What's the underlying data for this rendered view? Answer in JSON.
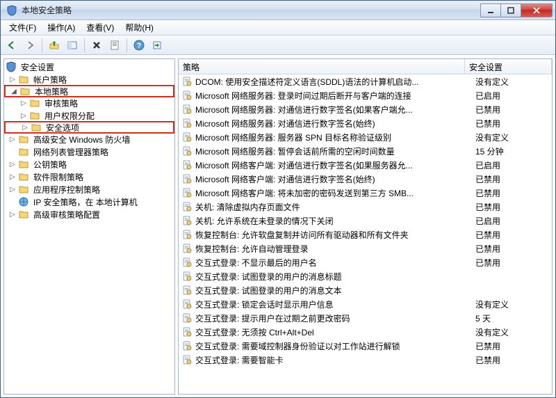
{
  "window": {
    "title": "本地安全策略"
  },
  "menubar": [
    {
      "label": "文件(F)"
    },
    {
      "label": "操作(A)"
    },
    {
      "label": "查看(V)"
    },
    {
      "label": "帮助(H)"
    }
  ],
  "toolbar_icons": [
    "back-arrow-icon",
    "forward-arrow-icon",
    "up-folder-icon",
    "show-hide-icon",
    "delete-icon",
    "properties-icon",
    "help-icon",
    "export-icon"
  ],
  "tree": {
    "root": {
      "label": "安全设置",
      "icon": "shield"
    },
    "nodes": [
      {
        "label": "帐户策略",
        "icon": "folder",
        "depth": 1,
        "expand": "closed"
      },
      {
        "label": "本地策略",
        "icon": "folder",
        "depth": 1,
        "expand": "open",
        "highlight": true
      },
      {
        "label": "审核策略",
        "icon": "folder",
        "depth": 2,
        "expand": "closed"
      },
      {
        "label": "用户权限分配",
        "icon": "folder",
        "depth": 2,
        "expand": "closed"
      },
      {
        "label": "安全选项",
        "icon": "folder",
        "depth": 2,
        "expand": "closed",
        "highlight": true
      },
      {
        "label": "高级安全 Windows 防火墙",
        "icon": "folder",
        "depth": 1,
        "expand": "closed"
      },
      {
        "label": "网络列表管理器策略",
        "icon": "folder",
        "depth": 1,
        "expand": "none"
      },
      {
        "label": "公钥策略",
        "icon": "folder",
        "depth": 1,
        "expand": "closed"
      },
      {
        "label": "软件限制策略",
        "icon": "folder",
        "depth": 1,
        "expand": "closed"
      },
      {
        "label": "应用程序控制策略",
        "icon": "folder",
        "depth": 1,
        "expand": "closed"
      },
      {
        "label": "IP 安全策略，在 本地计算机",
        "icon": "ipsec",
        "depth": 1,
        "expand": "none"
      },
      {
        "label": "高级审核策略配置",
        "icon": "folder",
        "depth": 1,
        "expand": "closed"
      }
    ]
  },
  "list": {
    "columns": {
      "policy": "策略",
      "setting": "安全设置"
    },
    "rows": [
      {
        "policy": "DCOM: 使用安全描述符定义语言(SDDL)语法的计算机启动...",
        "setting": "没有定义"
      },
      {
        "policy": "Microsoft 网络服务器: 登录时间过期后断开与客户端的连接",
        "setting": "已启用"
      },
      {
        "policy": "Microsoft 网络服务器: 对通信进行数字签名(如果客户端允...",
        "setting": "已禁用"
      },
      {
        "policy": "Microsoft 网络服务器: 对通信进行数字签名(始终)",
        "setting": "已禁用"
      },
      {
        "policy": "Microsoft 网络服务器: 服务器 SPN 目标名称验证级别",
        "setting": "没有定义"
      },
      {
        "policy": "Microsoft 网络服务器: 暂停会话前所需的空闲时间数量",
        "setting": "15 分钟"
      },
      {
        "policy": "Microsoft 网络客户端: 对通信进行数字签名(如果服务器允...",
        "setting": "已启用"
      },
      {
        "policy": "Microsoft 网络客户端: 对通信进行数字签名(始终)",
        "setting": "已禁用"
      },
      {
        "policy": "Microsoft 网络客户端: 将未加密的密码发送到第三方 SMB...",
        "setting": "已禁用"
      },
      {
        "policy": "关机: 清除虚拟内存页面文件",
        "setting": "已禁用"
      },
      {
        "policy": "关机: 允许系统在未登录的情况下关闭",
        "setting": "已启用"
      },
      {
        "policy": "恢复控制台: 允许软盘复制并访问所有驱动器和所有文件夹",
        "setting": "已禁用"
      },
      {
        "policy": "恢复控制台: 允许自动管理登录",
        "setting": "已禁用"
      },
      {
        "policy": "交互式登录: 不显示最后的用户名",
        "setting": "已禁用"
      },
      {
        "policy": "交互式登录: 试图登录的用户的消息标题",
        "setting": ""
      },
      {
        "policy": "交互式登录: 试图登录的用户的消息文本",
        "setting": ""
      },
      {
        "policy": "交互式登录: 锁定会话时显示用户信息",
        "setting": "没有定义"
      },
      {
        "policy": "交互式登录: 提示用户在过期之前更改密码",
        "setting": "5 天"
      },
      {
        "policy": "交互式登录: 无须按 Ctrl+Alt+Del",
        "setting": "没有定义"
      },
      {
        "policy": "交互式登录: 需要域控制器身份验证以对工作站进行解锁",
        "setting": "已禁用"
      },
      {
        "policy": "交互式登录: 需要智能卡",
        "setting": "已禁用"
      }
    ]
  }
}
